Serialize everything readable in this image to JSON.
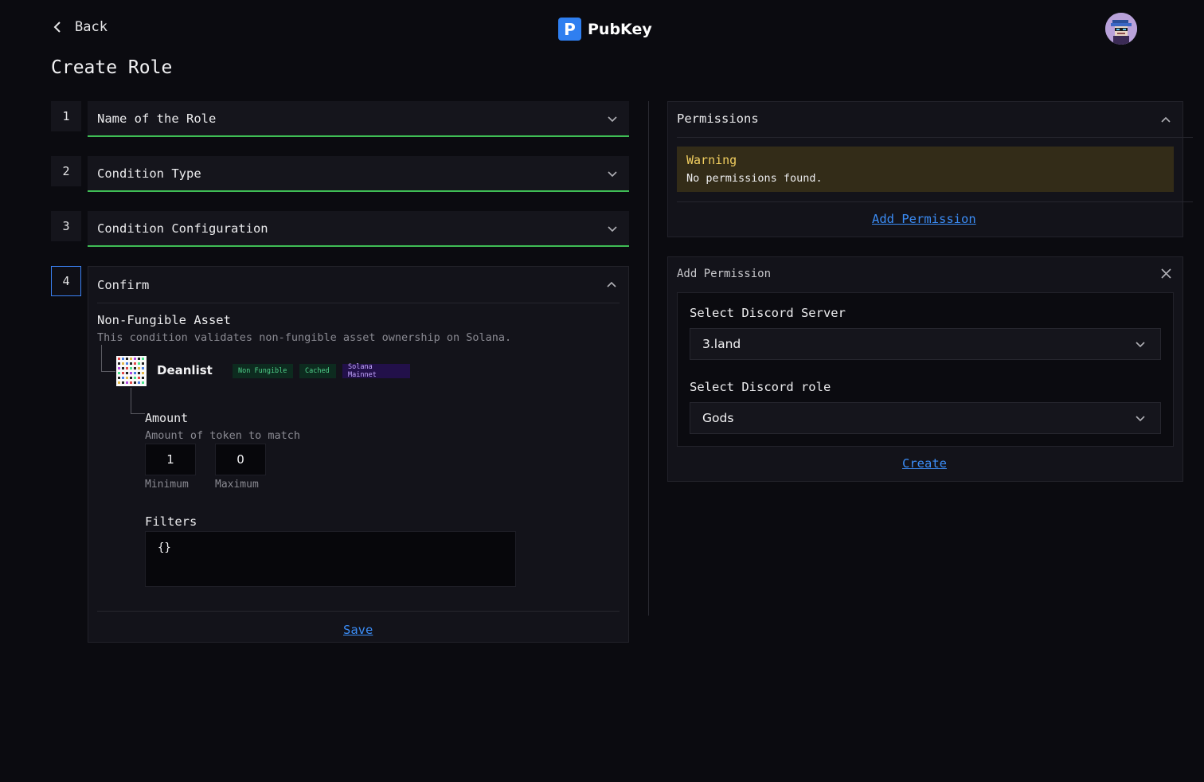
{
  "header": {
    "back_label": "Back",
    "logo_mark": "P",
    "logo_name": "PubKey",
    "avatar_icon": "user-avatar-icon"
  },
  "page": {
    "title": "Create Role"
  },
  "steps": [
    {
      "number": "1",
      "label": "Name of the Role"
    },
    {
      "number": "2",
      "label": "Condition Type"
    },
    {
      "number": "3",
      "label": "Condition Configuration"
    },
    {
      "number": "4",
      "label": "Confirm"
    }
  ],
  "confirm": {
    "condition_title": "Non-Fungible Asset",
    "condition_desc": "This condition validates non-fungible asset ownership on Solana.",
    "asset": {
      "name": "Deanlist",
      "tags": [
        "Non Fungible",
        "Cached",
        "Solana Mainnet"
      ]
    },
    "amount": {
      "title": "Amount",
      "desc": "Amount of token to match",
      "minimum_value": "1",
      "maximum_value": "0",
      "minimum_label": "Minimum",
      "maximum_label": "Maximum"
    },
    "filters": {
      "title": "Filters",
      "value": "{}"
    },
    "save_label": "Save"
  },
  "permissions": {
    "title": "Permissions",
    "warning_title": "Warning",
    "warning_text": "No permissions found.",
    "add_label": "Add Permission"
  },
  "add_permission": {
    "title": "Add Permission",
    "server_label": "Select Discord Server",
    "server_value": "3.land",
    "role_label": "Select Discord role",
    "role_value": "Gods",
    "create_label": "Create"
  },
  "colors": {
    "background": "#0b0b10",
    "panel": "#13131a",
    "accent_green": "#3fbd55",
    "accent_blue": "#3b82f6",
    "link": "#3b8cf5",
    "warning_bg": "#332c18",
    "warning_text": "#f2cf60"
  }
}
